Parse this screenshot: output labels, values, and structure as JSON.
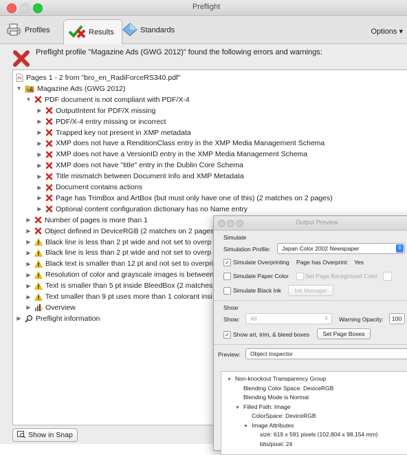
{
  "window": {
    "title": "Preflight"
  },
  "toolbar": {
    "tabs": [
      {
        "label": "Profiles",
        "icon": "profiles-icon"
      },
      {
        "label": "Results",
        "icon": "results-icon"
      },
      {
        "label": "Standards",
        "icon": "standards-icon"
      }
    ],
    "options_label": "Options"
  },
  "summary": {
    "text": "Preflight profile \"Magazine Ads (GWG 2012)\" found the following errors and warnings:"
  },
  "tree": [
    {
      "level": 0,
      "text": "Pages 1 - 2 from \"bro_en_RadiForceRS340.pdf\"",
      "icon": "pdf-icon",
      "expand": ""
    },
    {
      "level": 0,
      "text": "Magazine Ads (GWG 2012)",
      "icon": "profile-icon",
      "expand": "open"
    },
    {
      "level": 1,
      "text": "PDF document is not compliant with PDF/X-4",
      "icon": "error-icon",
      "expand": "open"
    },
    {
      "level": 2,
      "text": "OutputIntent for PDF/X missing",
      "icon": "error-icon",
      "expand": "closed"
    },
    {
      "level": 2,
      "text": "PDF/X-4 entry missing or incorrect",
      "icon": "error-icon",
      "expand": "closed"
    },
    {
      "level": 2,
      "text": "Trapped key not present in XMP metadata",
      "icon": "error-icon",
      "expand": "closed"
    },
    {
      "level": 2,
      "text": "XMP does not have a RenditionClass entry in the XMP Media Management Schema",
      "icon": "error-icon",
      "expand": "closed"
    },
    {
      "level": 2,
      "text": "XMP does not have a VersionID entry in the XMP Media Management Schema",
      "icon": "error-icon",
      "expand": "closed"
    },
    {
      "level": 2,
      "text": "XMP does not have \"title\" entry in the Dublin Core Schema",
      "icon": "error-icon",
      "expand": "closed"
    },
    {
      "level": 2,
      "text": "Title mismatch between Document Info and XMP Metadata",
      "icon": "error-icon",
      "expand": "closed"
    },
    {
      "level": 2,
      "text": "Document contains actions",
      "icon": "error-icon",
      "expand": "closed"
    },
    {
      "level": 2,
      "text": "Page has TrimBox and ArtBox (but must only have one of this) (2 matches on 2 pages)",
      "icon": "error-icon",
      "expand": "closed"
    },
    {
      "level": 2,
      "text": "Optional content configuration dictionary has no Name entry",
      "icon": "error-icon",
      "expand": "closed"
    },
    {
      "level": 1,
      "text": "Number of pages is more than 1",
      "icon": "error-icon",
      "expand": "closed"
    },
    {
      "level": 1,
      "text": "Object defined in DeviceRGB (2 matches on 2 pages",
      "icon": "error-icon",
      "expand": "closed"
    },
    {
      "level": 1,
      "text": "Black line is less than 2 pt wide and not set to overp",
      "icon": "warning-icon",
      "expand": "closed"
    },
    {
      "level": 1,
      "text": "Black line is less than 2 pt wide and not set to overp",
      "icon": "warning-icon",
      "expand": "closed"
    },
    {
      "level": 1,
      "text": "Black text is smaller than 12 pt and not set to overpri",
      "icon": "warning-icon",
      "expand": "closed"
    },
    {
      "level": 1,
      "text": "Resolution of color and grayscale images is between",
      "icon": "warning-icon",
      "expand": "closed"
    },
    {
      "level": 1,
      "text": "Text is smaller than 5 pt inside BleedBox (2 matches",
      "icon": "warning-icon",
      "expand": "closed"
    },
    {
      "level": 1,
      "text": "Text smaller than 9 pt uses more than 1 colorant insi",
      "icon": "warning-icon",
      "expand": "closed"
    },
    {
      "level": 1,
      "text": "Overview",
      "icon": "overview-icon",
      "expand": "closed"
    },
    {
      "level": 0,
      "text": "Preflight information",
      "icon": "magnifier-icon",
      "expand": "closed"
    }
  ],
  "snap_button": {
    "label": "Show in Snap"
  },
  "output_preview": {
    "title": "Output Preview",
    "simulate_header": "Simulate",
    "simulation_profile_label": "Simulation Profile:",
    "simulation_profile_value": "Japan Color 2002 Newspaper",
    "simulate_overprinting": "Simulate Overprinting",
    "page_has_overprint_label": "Page has Overprint:",
    "page_has_overprint_value": "Yes",
    "simulate_paper_color": "Simulate Paper Color",
    "set_page_background_color": "Set Page Background Color",
    "simulate_black_ink": "Simulate Black Ink",
    "ink_manager": "Ink Manager",
    "show_header": "Show",
    "show_label": "Show:",
    "show_value": "All",
    "warning_opacity_label": "Warning Opacity:",
    "warning_opacity_value": "100",
    "show_boxes": "Show art, trim, & bleed boxes",
    "set_page_boxes": "Set Page Boxes",
    "preview_label": "Preview:",
    "preview_value": "Object Inspector",
    "inspector": [
      {
        "level": 0,
        "text": "Non-knockout Transparency Group",
        "expand": "open"
      },
      {
        "level": 1,
        "text": "Blending Color Space: DeviceRGB",
        "expand": ""
      },
      {
        "level": 1,
        "text": "Blending Mode is Normal",
        "expand": ""
      },
      {
        "level": 1,
        "text": "Filled Path: Image",
        "expand": "open"
      },
      {
        "level": 2,
        "text": "ColorSpace: DeviceRGB",
        "expand": ""
      },
      {
        "level": 2,
        "text": "Image Attributes",
        "expand": "open"
      },
      {
        "level": 3,
        "text": "size: 619 x 591 pixels (102.804 x 98.154 mm)",
        "expand": ""
      },
      {
        "level": 3,
        "text": "bits/pixel: 24",
        "expand": ""
      }
    ]
  }
}
